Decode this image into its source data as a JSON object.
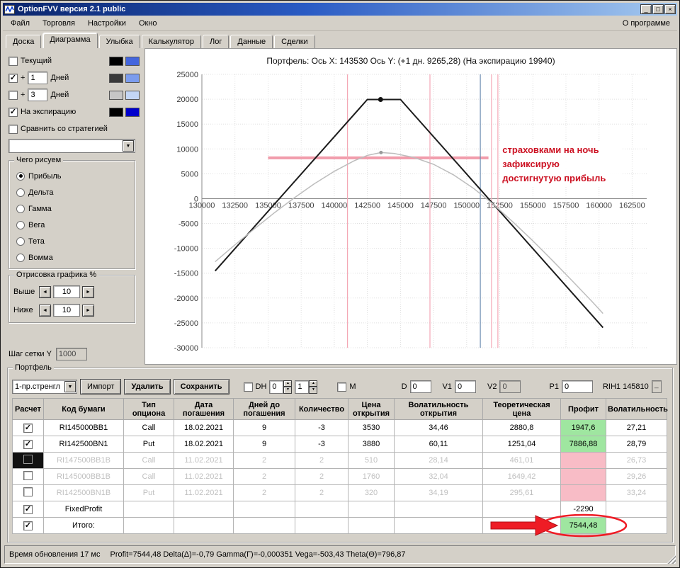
{
  "window": {
    "title": "OptionFVV версия 2.1 public"
  },
  "icons": {
    "minimize": "_",
    "maximize": "□",
    "close": "×",
    "dropdown": "▼",
    "spin_up": "▲",
    "spin_down": "▼",
    "step_left": "◄",
    "step_right": "►"
  },
  "menu": {
    "items": [
      "Файл",
      "Торговля",
      "Настройки",
      "Окно"
    ],
    "right_item": "О программе"
  },
  "tabs": [
    "Доска",
    "Диаграмма",
    "Улыбка",
    "Калькулятор",
    "Лог",
    "Данные",
    "Сделки"
  ],
  "active_tab": "Диаграмма",
  "colors": {
    "green": "#9fe6a0",
    "pink": "#f8bcc6",
    "red": "#ee1c25"
  },
  "left_panel": {
    "current": {
      "label": "Текущий",
      "checked": false,
      "colors": [
        "#000000",
        "#4466dd"
      ]
    },
    "plus1": {
      "prefix": "+",
      "value": "1",
      "label": "Дней",
      "checked": true,
      "colors": [
        "#3a3a3a",
        "#7b9cee"
      ]
    },
    "plus3": {
      "prefix": "+",
      "value": "3",
      "label": "Дней",
      "checked": false,
      "colors": [
        "#c6c6c6",
        "#c3d6f5"
      ]
    },
    "expiry": {
      "label": "На экспирацию",
      "checked": true,
      "colors": [
        "#000000",
        "#0000cc"
      ]
    },
    "compare": {
      "label": "Сравнить со стратегией",
      "checked": false
    },
    "strategy_dropdown_value": "",
    "draw_group": {
      "title": "Чего рисуем",
      "options": [
        "Прибыль",
        "Дельта",
        "Гамма",
        "Вега",
        "Тета",
        "Вомма"
      ],
      "selected": "Прибыль"
    },
    "range_group": {
      "title": "Отрисовка графика %",
      "above_label": "Выше",
      "above_value": "10",
      "below_label": "Ниже",
      "below_value": "10"
    },
    "grid_step": {
      "label": "Шаг сетки Y",
      "value": "1000"
    }
  },
  "chart_data": {
    "type": "line",
    "title": "Портфель: Ось X: 143530 Ось Y:  (+1 дн. 9265,28)  (На экспирацию 19940)",
    "xlabel": "",
    "ylabel": "",
    "xlim": [
      130000,
      163600
    ],
    "ylim": [
      -30000,
      25000
    ],
    "xticks": {
      "from": 130000,
      "to": 162500,
      "step": 2500
    },
    "yticks": {
      "from": -30000,
      "to": 25000,
      "step": 5000
    },
    "grid": true,
    "series": [
      {
        "name": "На экспирацию",
        "color": "#1c1c1c",
        "width": 2,
        "points": [
          [
            131000,
            -14560
          ],
          [
            142500,
            19940
          ],
          [
            145000,
            19940
          ],
          [
            160300,
            -25960
          ]
        ]
      },
      {
        "name": "+1 день",
        "color": "#bdbdbd",
        "width": 1.5,
        "points": [
          [
            131000,
            -12700
          ],
          [
            132500,
            -9300
          ],
          [
            134000,
            -6000
          ],
          [
            135500,
            -2800
          ],
          [
            137000,
            200
          ],
          [
            138500,
            3000
          ],
          [
            140000,
            5500
          ],
          [
            141500,
            7600
          ],
          [
            142500,
            8700
          ],
          [
            143530,
            9265
          ],
          [
            144500,
            9100
          ],
          [
            146000,
            8300
          ],
          [
            147500,
            6900
          ],
          [
            149000,
            4800
          ],
          [
            150500,
            2100
          ],
          [
            152000,
            -1100
          ],
          [
            153500,
            -4700
          ],
          [
            155000,
            -8500
          ],
          [
            156500,
            -12500
          ],
          [
            158000,
            -16600
          ],
          [
            159500,
            -20800
          ],
          [
            160300,
            -23100
          ]
        ]
      }
    ],
    "markers": {
      "dots": [
        {
          "x": 143500,
          "y": 19940,
          "color": "#111111",
          "r": 3.5
        },
        {
          "x": 143530,
          "y": 9265,
          "color": "#9a9a9a",
          "r": 2.5
        }
      ],
      "hbar": {
        "y": 8200,
        "x1": 135000,
        "x2": 151650,
        "color": "#f19cab",
        "width": 4
      },
      "vlines": [
        {
          "x": 141000,
          "color": "#f4a8b6"
        },
        {
          "x": 147230,
          "color": "#f4a8b6"
        },
        {
          "x": 151030,
          "color": "#6f8fb4"
        },
        {
          "x": 151880,
          "color": "#f4a8b6"
        },
        {
          "x": 152360,
          "color": "#f4a8b6"
        }
      ]
    },
    "annotation": {
      "x": 152700,
      "y": 11600,
      "color": "#cc1122",
      "lines": [
        "страховками на ночь",
        "зафиксирую",
        "достигнутую прибыль"
      ]
    }
  },
  "portfolio": {
    "group_title": "Портфель",
    "preset": "1-пр.стренгл",
    "import_label": "Импорт",
    "delete_label": "Удалить",
    "save_label": "Сохранить",
    "dh_label": "DH",
    "m_label": "М",
    "spin1": "0",
    "spin2": "1",
    "fields": {
      "d": {
        "label": "D",
        "value": "0"
      },
      "v1": {
        "label": "V1",
        "value": "0"
      },
      "v2": {
        "label": "V2",
        "value": "0"
      },
      "p1": {
        "label": "P1",
        "value": "0"
      }
    },
    "ticker": "RIH1 145810",
    "table": {
      "columns": [
        {
          "key": "calc",
          "label": "Расчет"
        },
        {
          "key": "code",
          "label": "Код бумаги"
        },
        {
          "key": "type",
          "label": "Тип опциона"
        },
        {
          "key": "date",
          "label": "Дата погашения"
        },
        {
          "key": "days",
          "label": "Дней до погашения"
        },
        {
          "key": "qty",
          "label": "Количество"
        },
        {
          "key": "open_price",
          "label": "Цена открытия"
        },
        {
          "key": "open_vol",
          "label": "Волатильность открытия"
        },
        {
          "key": "theo",
          "label": "Теоретическая цена"
        },
        {
          "key": "profit",
          "label": "Профит"
        },
        {
          "key": "vol",
          "label": "Волатильность"
        }
      ],
      "rows": [
        {
          "checked": true,
          "dim": false,
          "selected_cell": false,
          "code": "RI145000BB1",
          "type": "Call",
          "date": "18.02.2021",
          "days": "9",
          "qty": "-3",
          "open_price": "3530",
          "open_vol": "34,46",
          "theo": "2880,8",
          "profit": "1947,6",
          "profit_bg": "green",
          "vol": "27,21"
        },
        {
          "checked": true,
          "dim": false,
          "selected_cell": false,
          "code": "RI142500BN1",
          "type": "Put",
          "date": "18.02.2021",
          "days": "9",
          "qty": "-3",
          "open_price": "3880",
          "open_vol": "60,11",
          "theo": "1251,04",
          "profit": "7886,88",
          "profit_bg": "green",
          "vol": "28,79"
        },
        {
          "checked": false,
          "dim": true,
          "selected_cell": true,
          "code": "RI147500BB1B",
          "type": "Call",
          "date": "11.02.2021",
          "days": "2",
          "qty": "2",
          "open_price": "510",
          "open_vol": "28,14",
          "theo": "461,01",
          "profit": "",
          "profit_bg": "pink",
          "vol": "26,73"
        },
        {
          "checked": false,
          "dim": true,
          "selected_cell": false,
          "code": "RI145000BB1B",
          "type": "Call",
          "date": "11.02.2021",
          "days": "2",
          "qty": "2",
          "open_price": "1760",
          "open_vol": "32,04",
          "theo": "1649,42",
          "profit": "",
          "profit_bg": "pink",
          "vol": "29,26"
        },
        {
          "checked": false,
          "dim": true,
          "selected_cell": false,
          "code": "RI142500BN1B",
          "type": "Put",
          "date": "11.02.2021",
          "days": "2",
          "qty": "2",
          "open_price": "320",
          "open_vol": "34,19",
          "theo": "295,61",
          "profit": "",
          "profit_bg": "pink",
          "vol": "33,24"
        },
        {
          "checked": true,
          "dim": false,
          "selected_cell": false,
          "code": "FixedProfit",
          "type": "",
          "date": "",
          "days": "",
          "qty": "",
          "open_price": "",
          "open_vol": "",
          "theo": "",
          "profit": "-2290",
          "profit_bg": "white",
          "vol": ""
        },
        {
          "checked": true,
          "dim": false,
          "selected_cell": false,
          "code": "Итого:",
          "type": "",
          "date": "",
          "days": "",
          "qty": "",
          "open_price": "",
          "open_vol": "",
          "theo": "",
          "profit": "7544,48",
          "profit_bg": "green",
          "vol": ""
        }
      ]
    }
  },
  "status": {
    "update": "Время обновления 17 мс",
    "greeks": "Profit=7544,48 Delta(Δ)=-0,79 Gamma(Г)=-0,000351 Vega=-503,43 Theta(Θ)=796,87"
  }
}
